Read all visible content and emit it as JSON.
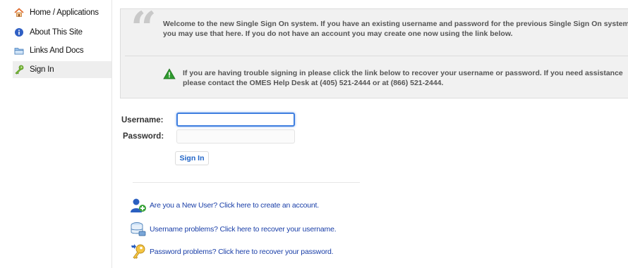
{
  "sidebar": {
    "items": [
      {
        "label": "Home / Applications",
        "icon": "home-icon"
      },
      {
        "label": "About This Site",
        "icon": "info-icon"
      },
      {
        "label": "Links And Docs",
        "icon": "folder-icon"
      },
      {
        "label": "Sign In",
        "icon": "key-icon",
        "active": true
      }
    ]
  },
  "welcome": {
    "message": "Welcome to the new Single Sign On system. If you have an existing username and password for the previous Single Sign On system you may use that here. If you do not have an account you may create one now using the link below.",
    "trouble": "If you are having trouble signing in please click the link below to recover your username or password. If you need assistance please contact the OMES Help Desk at (405) 521-2444 or at (866) 521-2444."
  },
  "form": {
    "username_label": "Username:",
    "password_label": "Password:",
    "username_value": "",
    "password_value": "",
    "submit_label": "Sign In"
  },
  "links": [
    {
      "text": "Are you a New User? Click here to create an account.",
      "icon": "new-user-icon"
    },
    {
      "text": "Username problems? Click here to recover your username.",
      "icon": "username-recovery-icon"
    },
    {
      "text": "Password problems? Click here to recover your password.",
      "icon": "password-recovery-icon"
    }
  ],
  "colors": {
    "link": "#1a3fa8",
    "button_text": "#1e63c7",
    "focus_border": "#3f7fe0",
    "warning_green": "#2e9b2e",
    "panel_bg": "#f1f1f1"
  }
}
